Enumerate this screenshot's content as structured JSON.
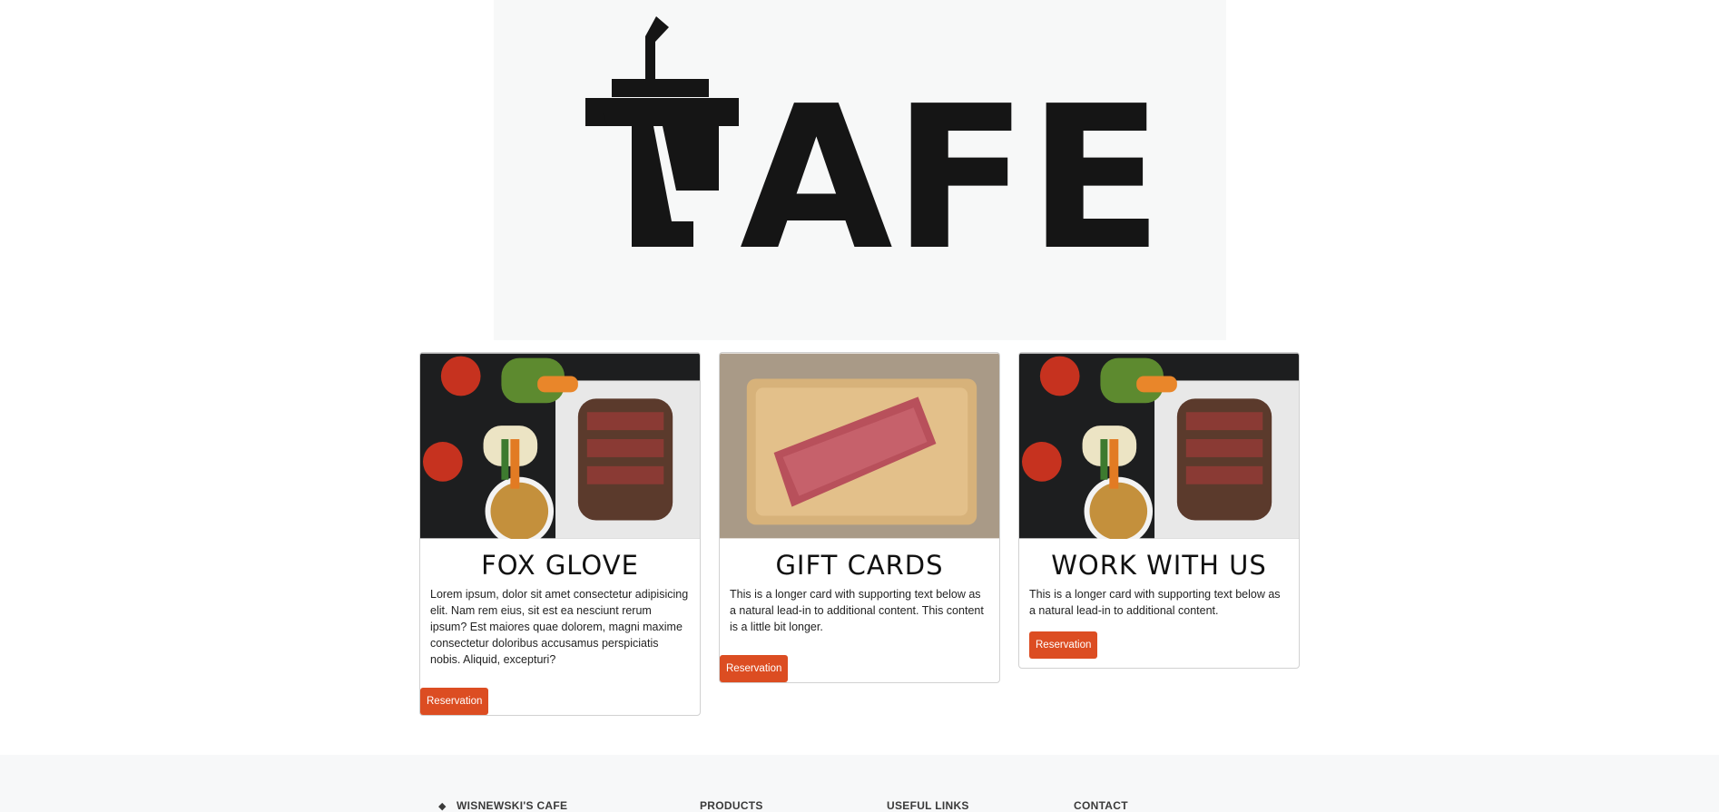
{
  "hero": {
    "logo_text": "AFE"
  },
  "cards": [
    {
      "title": "FOX GLOVE",
      "text": "Lorem ipsum, dolor sit amet consectetur adipisicing elit. Nam rem eius, sit est ea nesciunt rerum ipsum? Est maiores quae dolorem, magni maxime consectetur doloribus accusamus perspiciatis nobis. Aliquid, excepturi?",
      "button": "Reservation",
      "image": "steak-vegetables-photo"
    },
    {
      "title": "GIFT CARDS",
      "text": "This is a longer card with supporting text below as a natural lead-in to additional content. This content is a little bit longer.",
      "button": "Reservation",
      "image": "raw-steak-board-photo"
    },
    {
      "title": "WORK WITH US",
      "text": "This is a longer card with supporting text below as a natural lead-in to additional content.",
      "button": "Reservation",
      "image": "steak-vegetables-photo"
    }
  ],
  "footer": {
    "brand": "WISNEWSKI'S CAFE",
    "brand_icon": "gem-icon",
    "columns": [
      "PRODUCTS",
      "USEFUL LINKS",
      "CONTACT"
    ]
  },
  "colors": {
    "accent": "#dc4d22",
    "footer_bg": "#f7f8f9",
    "hero_bg": "#f7f8f8"
  }
}
